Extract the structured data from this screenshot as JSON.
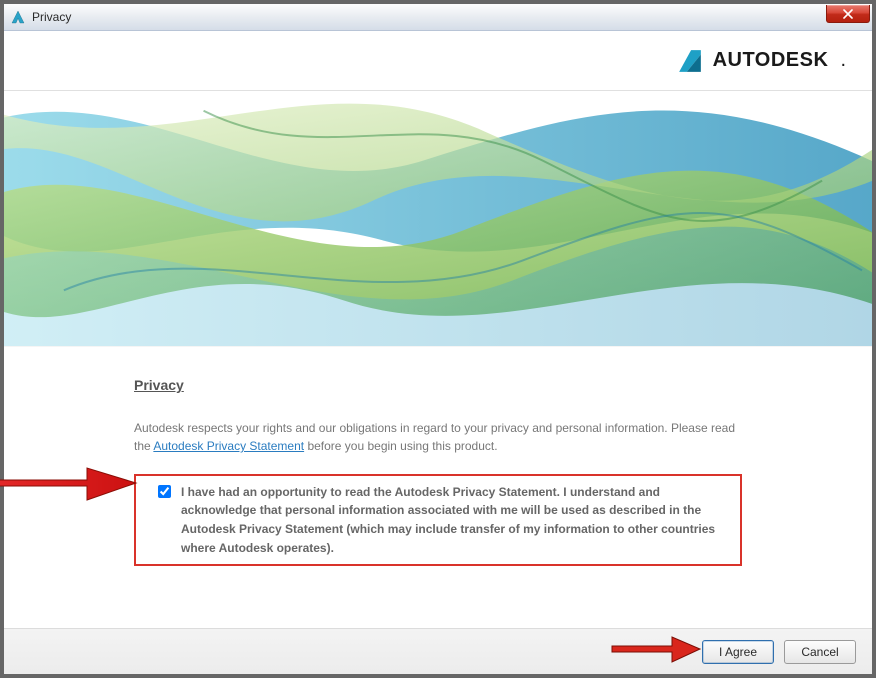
{
  "window": {
    "title": "Privacy"
  },
  "brand": {
    "name": "AUTODESK"
  },
  "content": {
    "section_title": "Privacy",
    "intro_before_link": "Autodesk respects your rights and our obligations in regard to your privacy and personal information. Please read the ",
    "link_text": "Autodesk Privacy Statement",
    "intro_after_link": " before you begin using this product.",
    "consent_text": "I have had an opportunity to read the Autodesk Privacy Statement. I understand and acknowledge that personal information associated with me will be used as described in the Autodesk Privacy Statement (which may include transfer of my information to other countries where Autodesk operates).",
    "consent_checked": true
  },
  "footer": {
    "agree_label": "I Agree",
    "cancel_label": "Cancel"
  }
}
